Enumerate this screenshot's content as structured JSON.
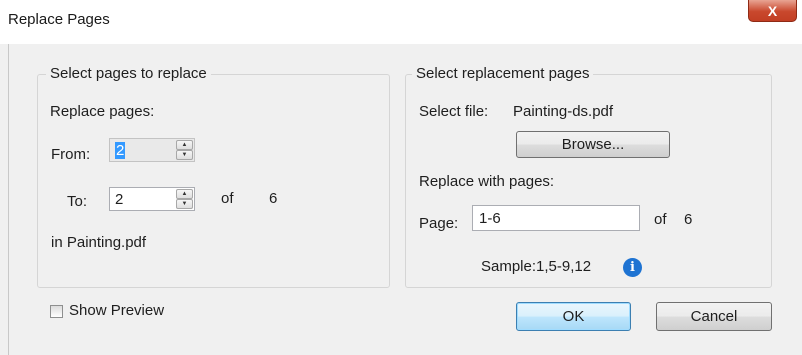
{
  "window": {
    "title": "Replace Pages",
    "close_glyph": "X"
  },
  "left_group": {
    "legend": "Select pages  to replace",
    "replace_pages_label": "Replace pages:",
    "from_label": "From:",
    "from_value": "2",
    "to_label": "To:",
    "to_value": "2",
    "of_label": "of",
    "total_pages": "6",
    "in_file": "in  Painting.pdf"
  },
  "right_group": {
    "legend": "Select replacement pages",
    "select_file_label": "Select file:",
    "file_name": "Painting-ds.pdf",
    "browse_label": "Browse...",
    "replace_with_label": "Replace with pages:",
    "page_label": "Page:",
    "page_value": "1-6",
    "of_label": "of",
    "total_pages": "6",
    "sample_text": "Sample:1,5-9,12",
    "info_glyph": "i"
  },
  "footer": {
    "show_preview_label": "Show Preview",
    "show_preview_checked": false,
    "ok_label": "OK",
    "cancel_label": "Cancel"
  },
  "icons": {
    "close": "close-icon",
    "spin_up": "spin-up-icon",
    "spin_down": "spin-down-icon",
    "info": "info-icon"
  }
}
